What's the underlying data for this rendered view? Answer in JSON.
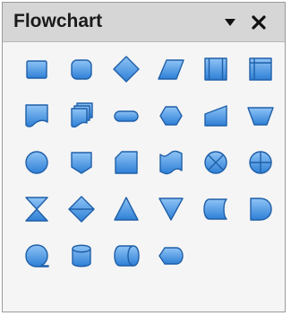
{
  "window": {
    "title": "Flowchart",
    "menu_icon": "triangle-down-icon",
    "close_icon": "close-x-icon"
  },
  "colors": {
    "shape_fill_top": "#8fc4f6",
    "shape_fill_bottom": "#2e7fd6",
    "shape_stroke": "#1f5fa8",
    "titlebar": "#d6d6d6",
    "panel_bg": "#f5f5f5"
  },
  "tools": [
    {
      "id": "process",
      "icon": "process-shape-icon"
    },
    {
      "id": "alternate-process",
      "icon": "alternate-process-shape-icon"
    },
    {
      "id": "decision",
      "icon": "decision-shape-icon"
    },
    {
      "id": "data",
      "icon": "data-shape-icon"
    },
    {
      "id": "predefined-process",
      "icon": "predefined-process-shape-icon"
    },
    {
      "id": "internal-storage",
      "icon": "internal-storage-shape-icon"
    },
    {
      "id": "document",
      "icon": "document-shape-icon"
    },
    {
      "id": "multidocument",
      "icon": "multidocument-shape-icon"
    },
    {
      "id": "terminator",
      "icon": "terminator-shape-icon"
    },
    {
      "id": "preparation",
      "icon": "preparation-shape-icon"
    },
    {
      "id": "manual-input",
      "icon": "manual-input-shape-icon"
    },
    {
      "id": "manual-operation",
      "icon": "manual-operation-shape-icon"
    },
    {
      "id": "connector",
      "icon": "connector-shape-icon"
    },
    {
      "id": "off-page-connector",
      "icon": "off-page-connector-shape-icon"
    },
    {
      "id": "card",
      "icon": "card-shape-icon"
    },
    {
      "id": "punched-tape",
      "icon": "punched-tape-shape-icon"
    },
    {
      "id": "summing-junction",
      "icon": "summing-junction-shape-icon"
    },
    {
      "id": "or",
      "icon": "or-shape-icon"
    },
    {
      "id": "collate",
      "icon": "collate-shape-icon"
    },
    {
      "id": "sort",
      "icon": "sort-shape-icon"
    },
    {
      "id": "extract",
      "icon": "extract-shape-icon"
    },
    {
      "id": "merge",
      "icon": "merge-shape-icon"
    },
    {
      "id": "stored-data",
      "icon": "stored-data-shape-icon"
    },
    {
      "id": "delay",
      "icon": "delay-shape-icon"
    },
    {
      "id": "sequential-access",
      "icon": "sequential-access-shape-icon"
    },
    {
      "id": "magnetic-disk",
      "icon": "magnetic-disk-shape-icon"
    },
    {
      "id": "direct-access-storage",
      "icon": "direct-access-storage-shape-icon"
    },
    {
      "id": "display",
      "icon": "display-shape-icon"
    }
  ]
}
